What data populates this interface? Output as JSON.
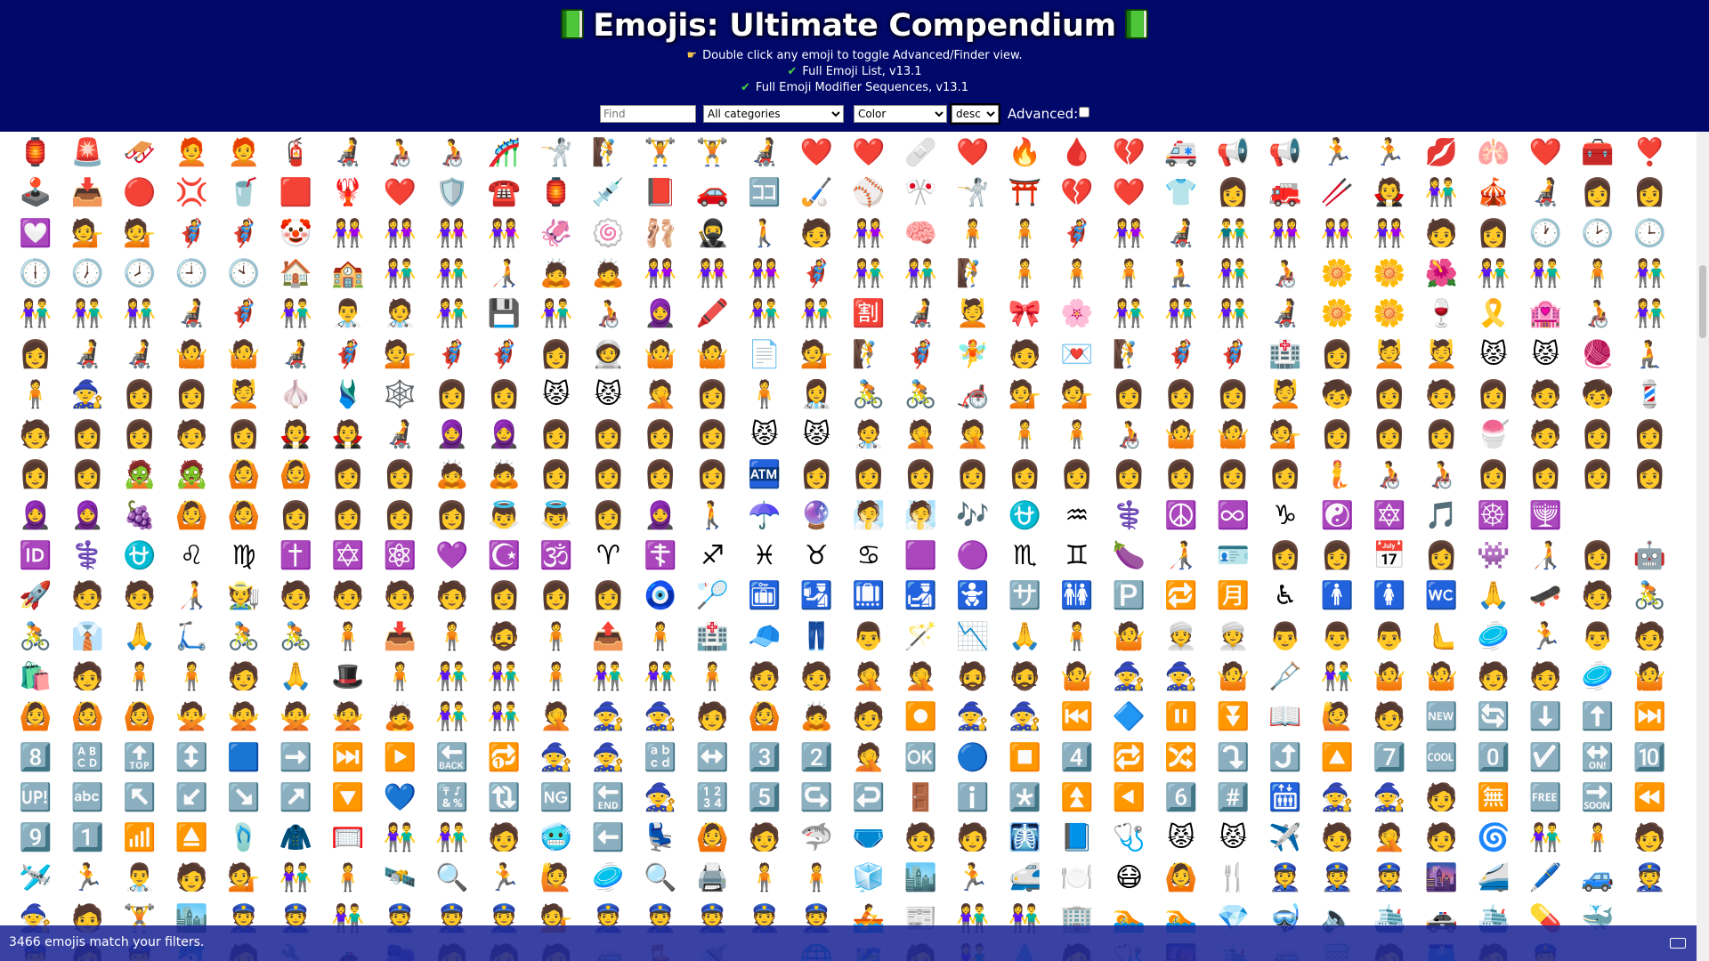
{
  "header": {
    "title": "Emojis: Ultimate Compendium",
    "hint": "Double click any emoji to toggle Advanced/Finder view.",
    "list_full": "Full Emoji List, v13.1",
    "list_modifier": "Full Emoji Modifier Sequences, v13.1"
  },
  "controls": {
    "find_placeholder": "Find",
    "category": "All categories",
    "color": "Color",
    "order": "desc",
    "advanced_label": "Advanced:"
  },
  "status": {
    "text": "3466 emojis match your filters."
  },
  "grid": {
    "rows": [
      [
        "🏮",
        "🚨",
        "🛷",
        "🧑‍🦰",
        "🧑‍🦰",
        "🧯",
        "🧑‍🦼",
        "🧑‍🦽",
        "🧑‍🦽",
        "🎢",
        "🤺",
        "🧗",
        "🏋️",
        "🏋️",
        "🧑‍🦼",
        "❤️",
        "❤️",
        "🩹",
        "❤️",
        "🔥",
        "🩸",
        "💔",
        "🚑",
        "📢",
        "📢",
        "🏃",
        "🏃",
        "💋",
        "🫁",
        "❤️",
        "🧰",
        "❣️",
        "🚩",
        "🧲"
      ],
      [
        "🕹️",
        "📥",
        "🔴",
        "💢",
        "🥤",
        "🟥",
        "🦞",
        "❤️",
        "🛡️",
        "☎️",
        "🏮",
        "💉",
        "📕",
        "🚗",
        "🈁",
        "🏑",
        "⚾",
        "🎌",
        "🤺",
        "⛩️",
        "💔",
        "❤️",
        "👕",
        "👩",
        "🚒",
        "🥢",
        "🧛",
        "👫",
        "🎪",
        "🧑‍🦼",
        "👩",
        "👩",
        "🩰"
      ],
      [
        "💟",
        "💁",
        "💁",
        "🦸",
        "🦸",
        "🤡",
        "👭",
        "👭",
        "👭",
        "👭",
        "🦑",
        "🍥",
        "🩰",
        "🥷",
        "🚶",
        "🧑",
        "👭",
        "🧠",
        "🧍",
        "🧍",
        "🦸",
        "👭",
        "🧑‍🦼",
        "👬",
        "👭",
        "👭",
        "👭",
        "🧑",
        "👩",
        "🕐",
        "🕑",
        "🕒",
        "🕓",
        "🕔"
      ],
      [
        "🕕",
        "🕖",
        "🕗",
        "🕘",
        "🕙",
        "🏠",
        "🏫",
        "👫",
        "👫",
        "🧑‍🦯",
        "🙇",
        "🙇",
        "👭",
        "👭",
        "👭",
        "🦸",
        "👫",
        "👫",
        "🧗",
        "🧍",
        "🧍",
        "🧍",
        "🧎",
        "👫",
        "🧑‍🦽",
        "🌼",
        "🌼",
        "🌺",
        "👫",
        "👫",
        "🧍",
        "👫",
        "👫",
        "👩"
      ],
      [
        "👫",
        "👫",
        "👫",
        "🧑‍🦼",
        "🦸",
        "👫",
        "👨‍⚕️",
        "🧑‍⚕️",
        "👫",
        "💾",
        "👫",
        "🧑‍🦽",
        "🧕",
        "🖍️",
        "👫",
        "👫",
        "🈹",
        "🧑‍🦼",
        "💆",
        "🎀",
        "🌸",
        "👫",
        "👫",
        "👫",
        "🧑‍🦼",
        "🌼",
        "🌼",
        "🍷",
        "🎗️",
        "🏩",
        "🧑‍🦽",
        "👫",
        "👫",
        "🧑‍🦯"
      ],
      [
        "👩",
        "🧑‍🦼",
        "🧑‍🦼",
        "🤷",
        "🤷",
        "🧑‍🦼",
        "🦸",
        "💁",
        "🦸",
        "🦸",
        "👩",
        "🧑‍🚀",
        "🤷",
        "🤷",
        "📄",
        "💁",
        "🧗",
        "🦸",
        "🧚",
        "🧑",
        "💌",
        "🧗",
        "🦸",
        "🦸",
        "🏥",
        "👩",
        "💆",
        "💆",
        "😾",
        "😾",
        "🧶",
        "🧎",
        "👩"
      ],
      [
        "🧍",
        "🧙",
        "👩",
        "👩",
        "💆",
        "🧄",
        "🩱",
        "🕸️",
        "👩",
        "👩",
        "😾",
        "😾",
        "🤦",
        "👩",
        "🧍",
        "👩‍⚕️",
        "🚴",
        "🚴",
        "🦽",
        "💁",
        "💁",
        "👩",
        "👩",
        "👩",
        "💆",
        "🧒",
        "👩",
        "🧑",
        "👩",
        "🧑",
        "🧒",
        "💈",
        "🧑"
      ],
      [
        "🧑",
        "👩",
        "👩",
        "🧑",
        "👩",
        "🧛",
        "🧛",
        "🧑‍🦼",
        "🧕",
        "🧕",
        "👩",
        "👩",
        "👩",
        "👩",
        "😾",
        "😾",
        "🧑‍⚕️",
        "🤦",
        "🤦",
        "🧍",
        "🧍",
        "🧑‍🦽",
        "🤷",
        "🤷",
        "💁",
        "👩",
        "👩",
        "👩",
        "🍧",
        "🧑",
        "👩",
        "👩",
        "👩",
        "👩"
      ],
      [
        "👩",
        "👩",
        "🧟",
        "🧟",
        "🙆",
        "🙆",
        "👩",
        "👩",
        "🙇",
        "🙇",
        "👩",
        "👩",
        "👩",
        "👩",
        "🏧",
        "👩",
        "👩",
        "👩",
        "👩",
        "👩",
        "👩",
        "👩",
        "👩",
        "👩",
        "👩",
        "🧜",
        "🧑‍🦽",
        "🧑‍🦽",
        "👩",
        "👩",
        "👩",
        "👩",
        "🈳"
      ],
      [
        "🧕",
        "🧕",
        "🍇",
        "🙆",
        "🙆",
        "👩",
        "👩",
        "👩",
        "👩",
        "👼",
        "👼",
        "👩",
        "🧕",
        "🚶",
        "☂️",
        "🔮",
        "🧖",
        "🧖",
        "🎶",
        "⛎",
        "♒",
        "⚕️",
        "☮️",
        "♾️",
        "♑",
        "☯️",
        "🔯",
        "🎵",
        "☸️",
        "🕎"
      ],
      [
        "🆔",
        "⚕️",
        "⛎",
        "♌",
        "♍",
        "✝️",
        "✡️",
        "⚛️",
        "💜",
        "☪️",
        "🕉️",
        "♈",
        "☦️",
        "♐",
        "♓",
        "♉",
        "♋",
        "🟪",
        "🟣",
        "♏",
        "♊",
        "🍆",
        "🧑‍🦯",
        "🪪",
        "👩",
        "👩",
        "📅",
        "👩",
        "👾",
        "🧑‍🦯",
        "👩",
        "🤖"
      ],
      [
        "🚀",
        "🧑",
        "🧑",
        "🧑‍🦯",
        "🧑‍🌾",
        "🧑",
        "🧑",
        "🧑",
        "🧑",
        "👩",
        "👩",
        "👩",
        "🧿",
        "🏸",
        "🛅",
        "🛂",
        "🛄",
        "🛃",
        "🚼",
        "🈂️",
        "🚻",
        "🅿️",
        "🔁",
        "🈷️",
        "♿",
        "🚹",
        "🚺",
        "🚾",
        "🙏",
        "🛹",
        "🧑",
        "🚴"
      ],
      [
        "🚴",
        "👔",
        "🙏",
        "🛴",
        "🚴",
        "🚴",
        "🧍",
        "📥",
        "🧍",
        "🧔",
        "🧍",
        "📤",
        "🧍",
        "🏥",
        "🧢",
        "👖",
        "👨",
        "🪄",
        "📉",
        "🙏",
        "🧍",
        "🤷",
        "👳",
        "👳",
        "👨",
        "👨",
        "👨",
        "🫷",
        "🥏",
        "🏃",
        "👨",
        "🧑",
        "🧑"
      ],
      [
        "🛍️",
        "🧑",
        "🧍",
        "🧍",
        "🧑",
        "🙏",
        "🎩",
        "🧍",
        "👫",
        "👫",
        "🧍",
        "👫",
        "👫",
        "🧍",
        "🧑",
        "🧑",
        "🤦",
        "🤦",
        "🧔",
        "🧔",
        "🤷",
        "🧙",
        "🧙",
        "🤷",
        "🩼",
        "👫",
        "🤷",
        "🤷",
        "🧑",
        "🧑",
        "🥏",
        "🤷",
        "🧑",
        "🧑"
      ],
      [
        "🙆",
        "🙆",
        "🙆",
        "🙅",
        "🙅",
        "🙅",
        "🙅",
        "🙇",
        "👫",
        "👫",
        "🤦",
        "🧙",
        "🧙",
        "🧑",
        "🙆",
        "🙇",
        "🧑",
        "⏺️",
        "🧙",
        "🧙",
        "⏮️",
        "🔷",
        "⏸️",
        "⏬",
        "📖",
        "🙋",
        "🧑",
        "🆕",
        "🔄",
        "⬇️",
        "⬆️",
        "⏭️",
        "⏩",
        "🔷"
      ],
      [
        "8️⃣",
        "🔠",
        "🔝",
        "↕️",
        "🟦",
        "➡️",
        "⏭️",
        "▶️",
        "🔙",
        "🔂",
        "🧙",
        "🧙",
        "🔡",
        "↔️",
        "3️⃣",
        "2️⃣",
        "🤦",
        "🆗",
        "🔵",
        "⏹️",
        "4️⃣",
        "🔁",
        "🔀",
        "⤵️",
        "⤴️",
        "🔼",
        "7️⃣",
        "🆒",
        "0️⃣",
        "☑️",
        "🔛",
        "🔟"
      ],
      [
        "🆙",
        "🔤",
        "↖️",
        "↙️",
        "↘️",
        "↗️",
        "🔽",
        "💙",
        "🔣",
        "🔃",
        "🆖",
        "🔚",
        "🧙",
        "🔢",
        "5️⃣",
        "↪️",
        "↩️",
        "🚪",
        "ℹ️",
        "*️⃣",
        "⏫",
        "◀️",
        "6️⃣",
        "#️⃣",
        "🛗",
        "🧙",
        "🧙",
        "🧑",
        "🈚",
        "🆓",
        "🔜",
        "⏪"
      ],
      [
        "9️⃣",
        "1️⃣",
        "📶",
        "⏏️",
        "🩴",
        "🧥",
        "🥅",
        "👫",
        "👫",
        "🧑",
        "🥶",
        "⬅️",
        "💺",
        "🙆",
        "🧑",
        "🦈",
        "🩲",
        "🧑",
        "🧑",
        "🩻",
        "📘",
        "🩺",
        "😾",
        "😾",
        "✈️",
        "🧑",
        "🤦",
        "🧑",
        "🌀",
        "👫",
        "🧍",
        "🧑",
        "🗂️",
        "🧑"
      ],
      [
        "🛩️",
        "🏃",
        "👨‍⚕️",
        "🧑",
        "💁",
        "👫",
        "🧍",
        "🛰️",
        "🔍",
        "🏃",
        "🙋",
        "🥏",
        "🔍",
        "🖨️",
        "🧍",
        "🧍",
        "🧊",
        "🏙️",
        "🏃",
        "🚅",
        "🍽️",
        "😷",
        "🙆",
        "🍴",
        "👮",
        "👮",
        "👮",
        "🌆",
        "🚄",
        "🖊️",
        "🚙",
        "👮",
        "👮"
      ],
      [
        "🧙",
        "🧑",
        "🏋️",
        "🏙️",
        "👮",
        "👮",
        "👫",
        "👮",
        "👮",
        "👮",
        "💁",
        "👮",
        "👮",
        "👮",
        "👮",
        "👮",
        "🚣",
        "📰",
        "👫",
        "👫",
        "🏢",
        "🏊",
        "🏊",
        "💎",
        "🤿",
        "🔈",
        "🛳️",
        "🚓",
        "🛳️",
        "💊",
        "🐳"
      ],
      [
        "👮",
        "🧑",
        "👮",
        "🐬",
        "🧑",
        "🔧",
        "🚓",
        "🫐",
        "🧑",
        "🧑",
        "🧑",
        "🚐",
        "🪑",
        "🚿",
        "🚤",
        "🌐",
        "🗺️",
        "🧑",
        "👫",
        "💧",
        "🧑",
        "🩺",
        "🌆",
        "🛳️",
        "🚐",
        "🗑️",
        "🧑",
        "🩳",
        "🧑",
        "👮"
      ]
    ]
  }
}
